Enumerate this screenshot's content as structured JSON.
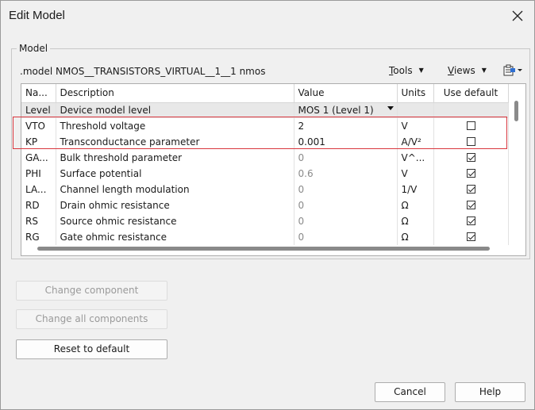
{
  "window": {
    "title": "Edit Model"
  },
  "group": {
    "label": "Model",
    "model_line": ".model NMOS__TRANSISTORS_VIRTUAL__1__1   nmos"
  },
  "menus": {
    "tools": {
      "first": "T",
      "rest": "ools"
    },
    "views": {
      "first": "V",
      "rest": "iews"
    }
  },
  "grid": {
    "headers": {
      "name": "Na...",
      "description": "Description",
      "value": "Value",
      "units": "Units",
      "use_default": "Use default"
    },
    "rows": [
      {
        "name": "Level",
        "description": "Device model level",
        "value": "MOS 1 (Level 1)",
        "units": "",
        "use_default": null,
        "value_muted": false
      },
      {
        "name": "VTO",
        "description": "Threshold voltage",
        "value": "2",
        "units": "V",
        "use_default": false,
        "value_muted": false
      },
      {
        "name": "KP",
        "description": "Transconductance parameter",
        "value": "0.001",
        "units": "A/V²",
        "use_default": false,
        "value_muted": false
      },
      {
        "name": "GA...",
        "description": "Bulk threshold parameter",
        "value": "0",
        "units": "V^...",
        "use_default": true,
        "value_muted": true
      },
      {
        "name": "PHI",
        "description": "Surface potential",
        "value": "0.6",
        "units": "V",
        "use_default": true,
        "value_muted": true
      },
      {
        "name": "LA...",
        "description": "Channel length modulation",
        "value": "0",
        "units": "1/V",
        "use_default": true,
        "value_muted": true
      },
      {
        "name": "RD",
        "description": "Drain ohmic resistance",
        "value": "0",
        "units": "Ω",
        "use_default": true,
        "value_muted": true
      },
      {
        "name": "RS",
        "description": "Source ohmic resistance",
        "value": "0",
        "units": "Ω",
        "use_default": true,
        "value_muted": true
      },
      {
        "name": "RG",
        "description": "Gate ohmic resistance",
        "value": "0",
        "units": "Ω",
        "use_default": true,
        "value_muted": true
      }
    ]
  },
  "buttons": {
    "change_component": "Change component",
    "change_all": "Change all components",
    "reset": "Reset to default",
    "cancel": "Cancel",
    "help": "Help"
  },
  "colors": {
    "highlight": "#d9363e",
    "selected_row": "#e8e8e8"
  }
}
